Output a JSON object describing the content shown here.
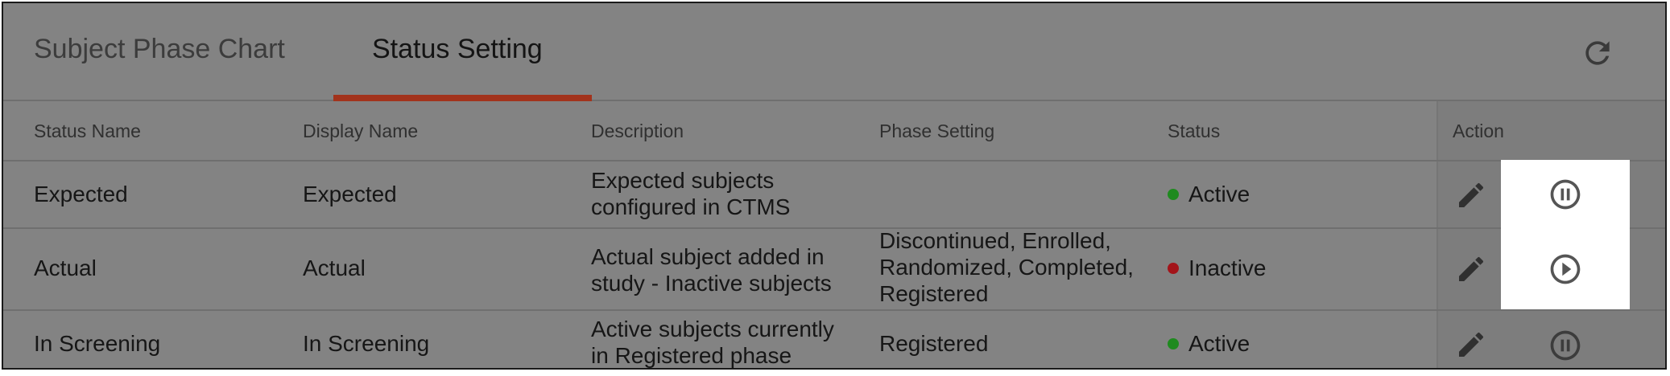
{
  "tabs": [
    {
      "label": "Subject Phase Chart",
      "active": false
    },
    {
      "label": "Status Setting",
      "active": true
    }
  ],
  "colors": {
    "accent": "#a2331c",
    "active_dot": "#1f8a1f",
    "inactive_dot": "#a3141a",
    "overlay": "#838383"
  },
  "table": {
    "headers": {
      "status_name": "Status Name",
      "display_name": "Display Name",
      "description": "Description",
      "phase_setting": "Phase Setting",
      "status": "Status",
      "action": "Action"
    },
    "rows": [
      {
        "status_name": "Expected",
        "display_name": "Expected",
        "description": "Expected subjects configured in CTMS",
        "phase_setting": "",
        "status": "Active",
        "toggle_icon": "pause-circle-icon"
      },
      {
        "status_name": "Actual",
        "display_name": "Actual",
        "description": "Actual subject added in study - Inactive subjects",
        "phase_setting": "Discontinued, Enrolled, Randomized, Completed, Registered",
        "status": "Inactive",
        "toggle_icon": "play-circle-icon"
      },
      {
        "status_name": "In Screening",
        "display_name": "In Screening",
        "description": "Active subjects currently in Registered phase",
        "phase_setting": "Registered",
        "status": "Active",
        "toggle_icon": "pause-circle-icon"
      }
    ]
  },
  "icons": {
    "refresh": "refresh-icon",
    "edit": "pencil-icon"
  }
}
